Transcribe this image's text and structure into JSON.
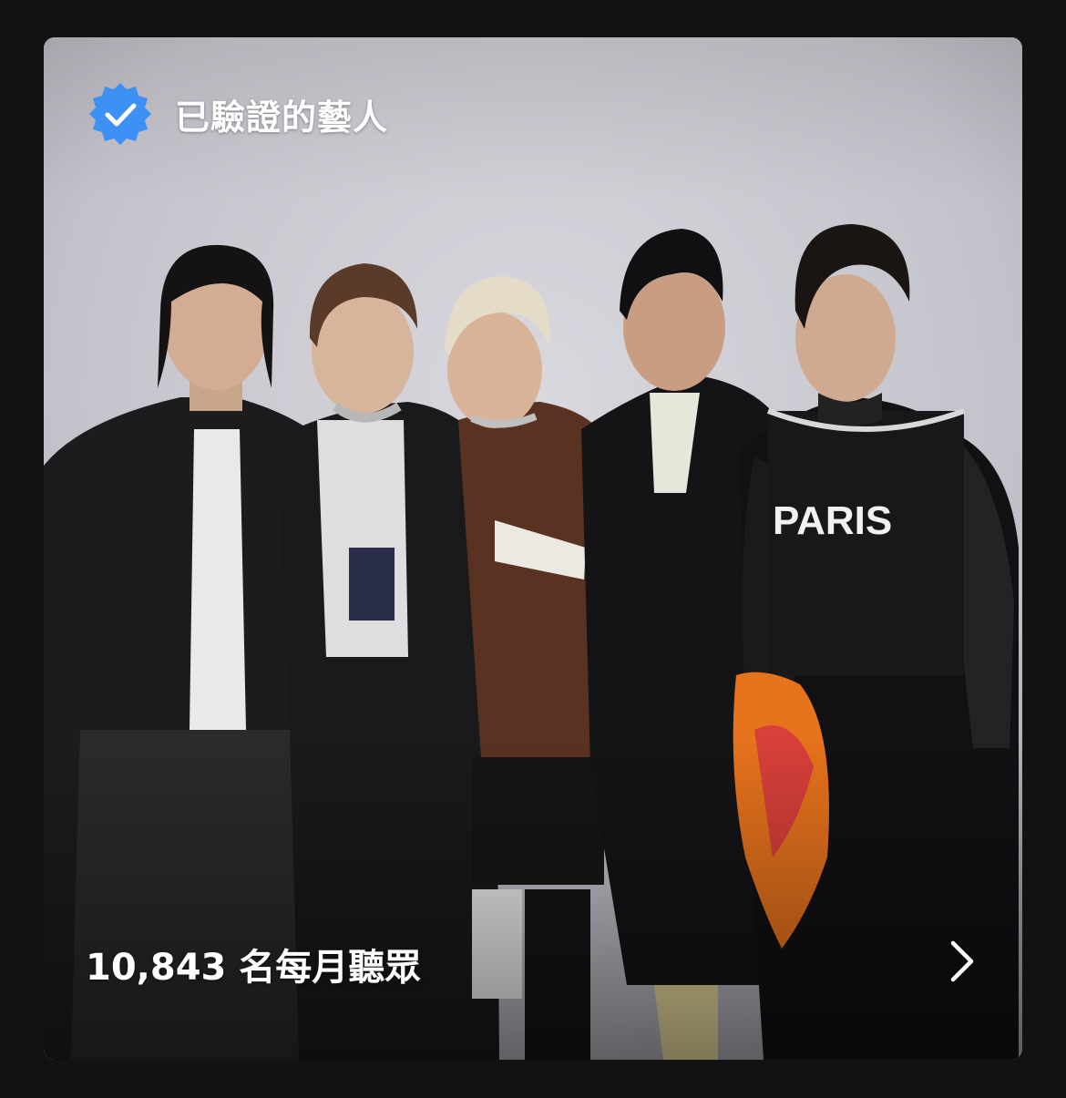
{
  "artist_card": {
    "verified_label": "已驗證的藝人",
    "monthly_listeners": "10,843 名每月聽眾",
    "icons": {
      "verified": "verified-badge-icon",
      "chevron": "chevron-right-icon"
    },
    "colors": {
      "background": "#121212",
      "verified_badge": "#3d91f4",
      "text": "#ffffff"
    },
    "image_alt": "Artist photo: five band members posing in front of a grey backdrop"
  }
}
